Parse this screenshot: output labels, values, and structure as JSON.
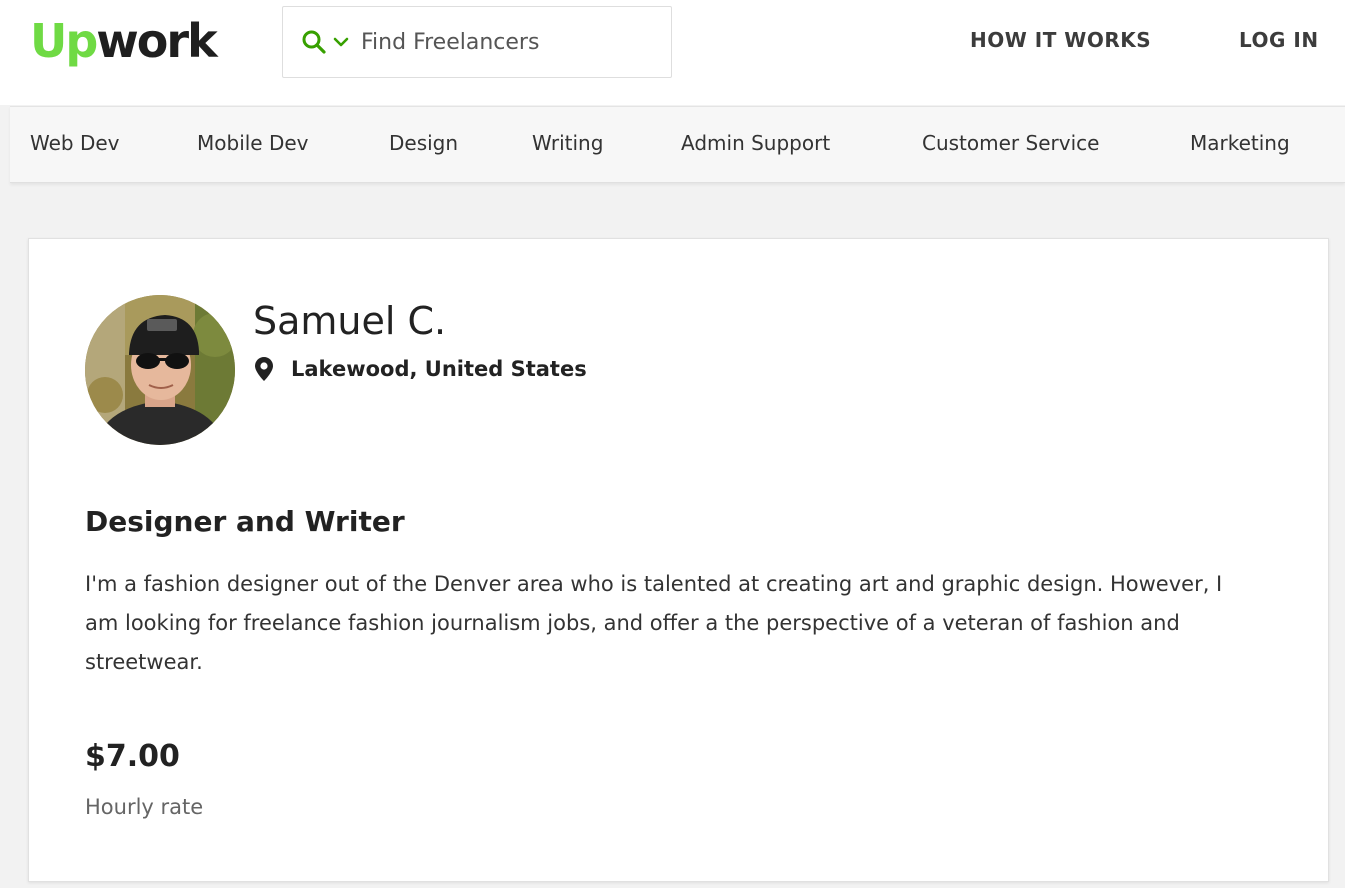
{
  "brand": {
    "logo_up": "Up",
    "logo_work": "work",
    "accent_color": "#6fda44"
  },
  "search": {
    "icon": "search-icon",
    "dropdown_icon": "chevron-down-icon",
    "placeholder": "Find Freelancers",
    "value": ""
  },
  "header": {
    "how_it_works": "HOW IT WORKS",
    "log_in": "LOG IN"
  },
  "categories": [
    "Web Dev",
    "Mobile Dev",
    "Design",
    "Writing",
    "Admin Support",
    "Customer Service",
    "Marketing"
  ],
  "profile": {
    "name": "Samuel C.",
    "location_icon": "map-pin-icon",
    "location": "Lakewood, United States",
    "title": "Designer and Writer",
    "description": "I'm a fashion designer out of the Denver area who is talented at creating art and graphic design. However, I am looking for freelance fashion journalism jobs, and offer a the perspective of a veteran of fashion and streetwear.",
    "rate": "$7.00",
    "rate_label": "Hourly rate"
  }
}
